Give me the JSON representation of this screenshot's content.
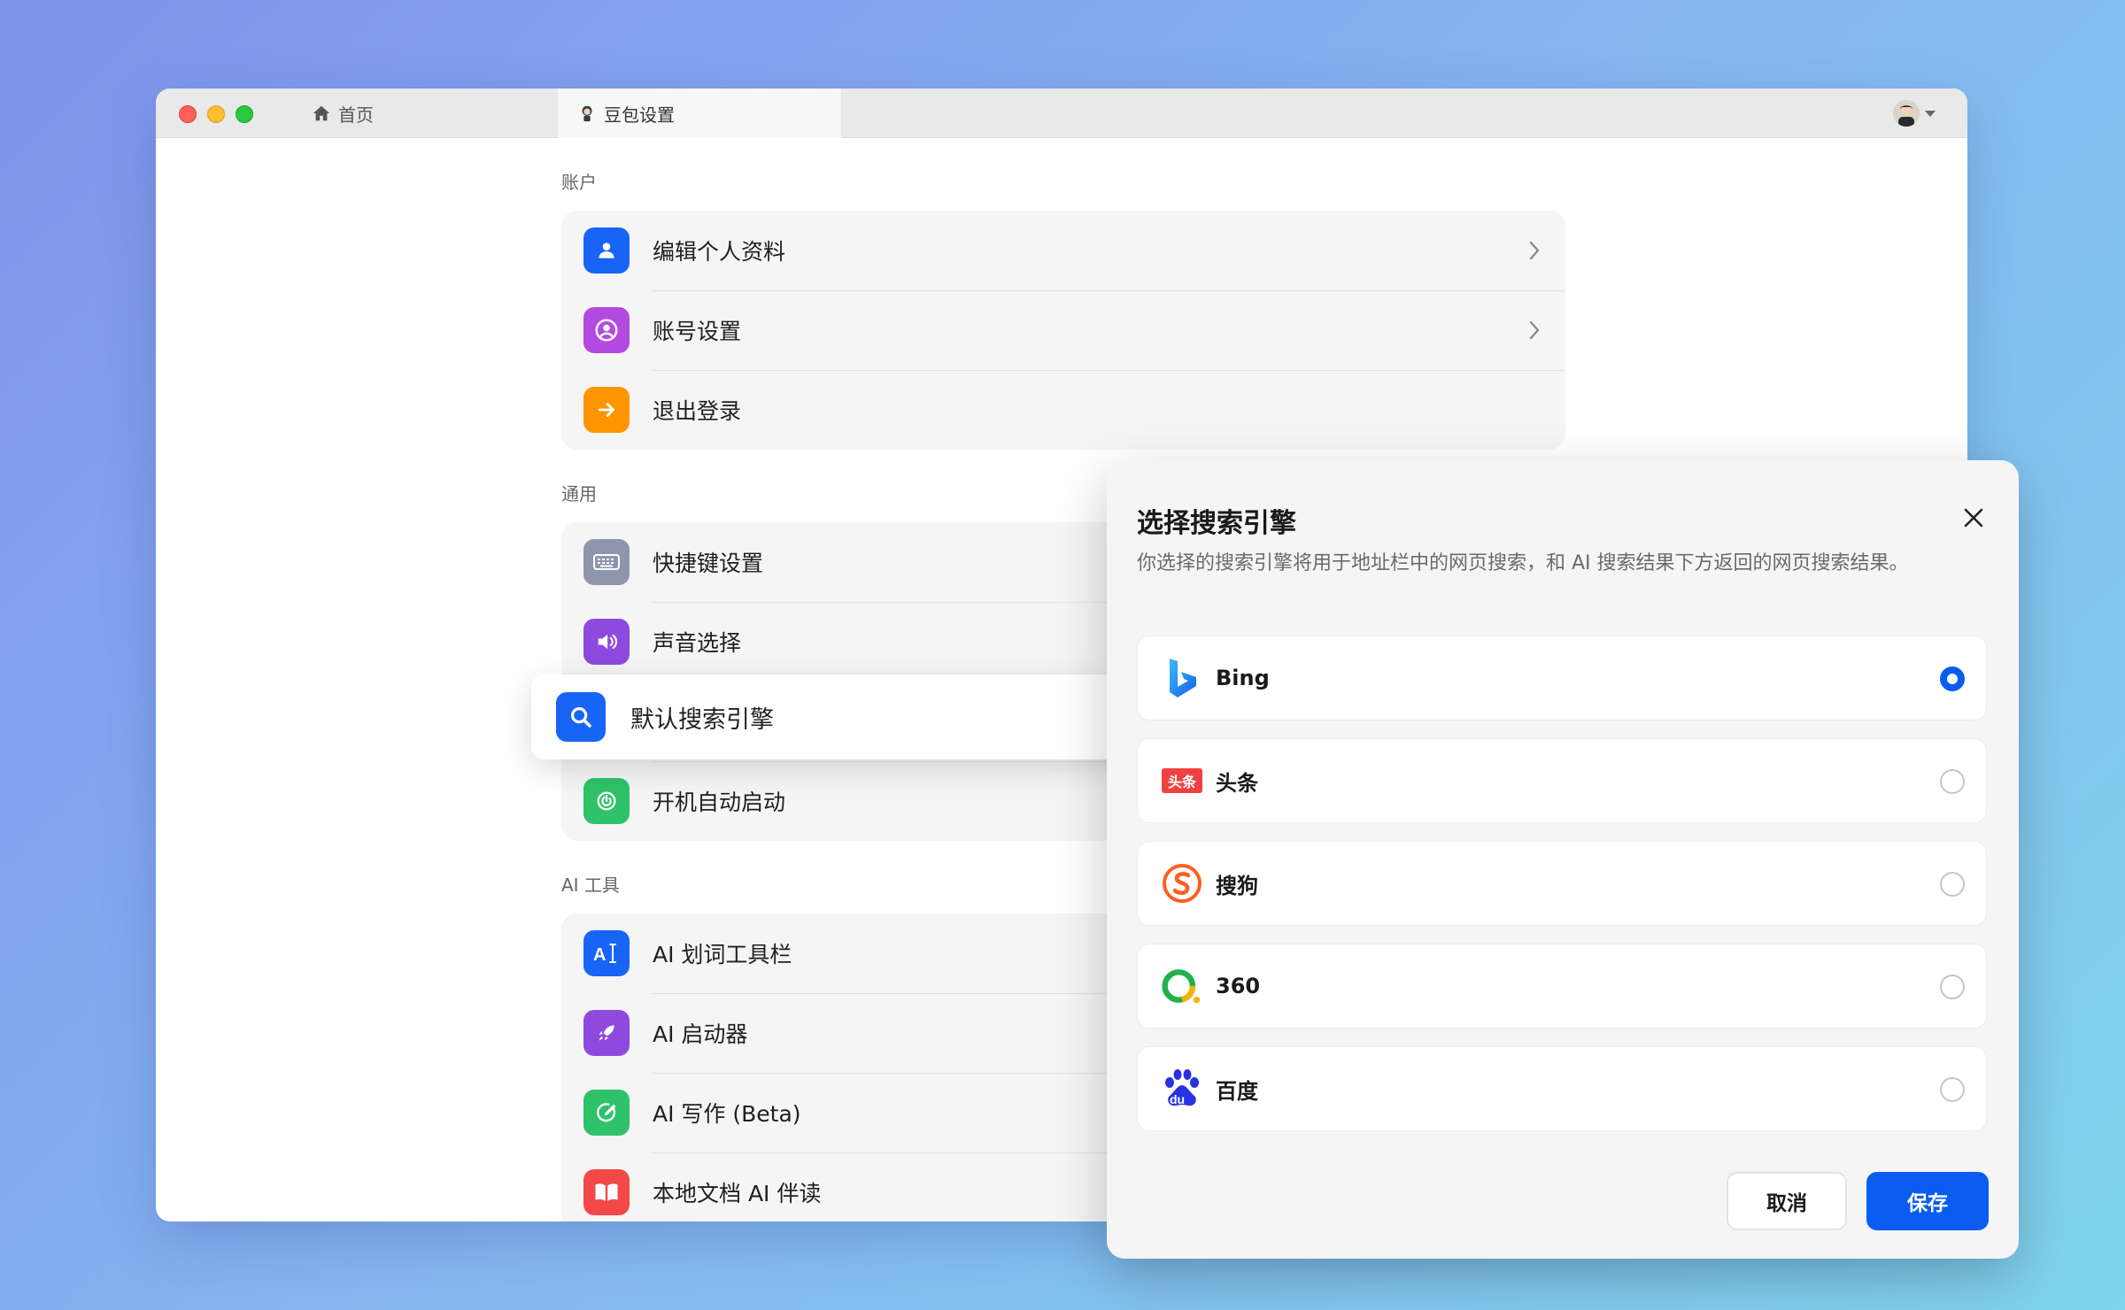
{
  "tabs": {
    "home": "首页",
    "settings": "豆包设置"
  },
  "sections": {
    "account": {
      "label": "账户",
      "items": [
        {
          "label": "编辑个人资料",
          "icon": "person-icon",
          "color": "#1864f5"
        },
        {
          "label": "账号设置",
          "icon": "account-circle-icon",
          "color": "#b449e0"
        },
        {
          "label": "退出登录",
          "icon": "arrow-right-icon",
          "color": "#ff9500"
        }
      ]
    },
    "general": {
      "label": "通用",
      "items": [
        {
          "label": "快捷键设置",
          "icon": "keyboard-icon",
          "color": "#8d96ad"
        },
        {
          "label": "声音选择",
          "icon": "speaker-icon",
          "color": "#8e49de"
        },
        {
          "label": "默认搜索引擎",
          "icon": "search-icon",
          "color": "#1864f5"
        },
        {
          "label": "开机自动启动",
          "icon": "power-icon",
          "color": "#2ec26a"
        }
      ]
    },
    "ai_tools": {
      "label": "AI 工具",
      "items": [
        {
          "label": "AI 划词工具栏",
          "icon": "ai-text-cursor-icon",
          "color": "#1864f5"
        },
        {
          "label": "AI 启动器",
          "icon": "rocket-icon",
          "color": "#8e49de"
        },
        {
          "label": "AI 写作 (Beta)",
          "icon": "pen-circle-icon",
          "color": "#2ec26a"
        },
        {
          "label": "本地文档 AI 伴读",
          "icon": "book-icon",
          "color": "#f24848"
        }
      ]
    }
  },
  "dialog": {
    "title": "选择搜索引擎",
    "description": "你选择的搜索引擎将用于地址栏中的网页搜索，和 AI 搜索结果下方返回的网页搜索结果。",
    "engines": [
      {
        "name": "Bing",
        "logo": "bing-logo",
        "selected": true
      },
      {
        "name": "头条",
        "logo": "toutiao-logo",
        "logo_text": "头条",
        "selected": false
      },
      {
        "name": "搜狗",
        "logo": "sogou-logo",
        "selected": false
      },
      {
        "name": "360",
        "logo": "360-logo",
        "selected": false
      },
      {
        "name": "百度",
        "logo": "baidu-logo",
        "logo_text": "du",
        "selected": false
      }
    ],
    "cancel_label": "取消",
    "save_label": "保存",
    "accent_color": "#0b5cf0"
  }
}
